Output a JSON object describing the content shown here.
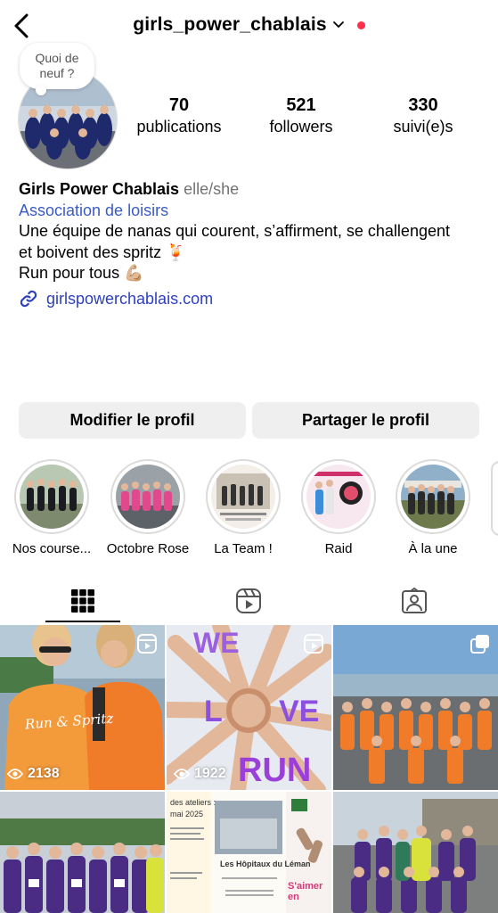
{
  "header": {
    "username": "girls_power_chablais"
  },
  "note": {
    "text": "Quoi de neuf ?"
  },
  "stats": {
    "posts_count": "70",
    "posts_label": "publications",
    "followers_count": "521",
    "followers_label": "followers",
    "following_count": "330",
    "following_label": "suivi(e)s"
  },
  "bio": {
    "name": "Girls Power Chablais",
    "pronouns": "elle/she",
    "category": "Association de loisirs",
    "line1": "Une équipe de nanas qui courent, s’affirment, se challengent",
    "line2": "et boivent des spritz 🍹",
    "line3": "Run pour tous 💪🏼",
    "link": "girlspowerchablais.com"
  },
  "buttons": {
    "edit": "Modifier le profil",
    "share": "Partager le profil"
  },
  "highlights": [
    {
      "label": "Nos course..."
    },
    {
      "label": "Octobre Rose"
    },
    {
      "label": "La Team !"
    },
    {
      "label": "Raid"
    },
    {
      "label": "À la une"
    }
  ],
  "grid": {
    "posts": [
      {
        "views": "2138",
        "type": "reel",
        "shirt_text": "Run & Spritz"
      },
      {
        "views": "1922",
        "type": "reel",
        "overlay_text": [
          "WE",
          "L",
          "VE",
          "RUN"
        ]
      },
      {
        "type": "carousel"
      },
      {
        "type": "photo"
      },
      {
        "type": "document",
        "lines": [
          "des ateliers :",
          "mai 2025",
          "Les Hôpitaux du Léman",
          "S'aimer en"
        ]
      },
      {
        "type": "photo"
      }
    ]
  },
  "colors": {
    "link_blue": "#3b5bc6",
    "button_bg": "#efefef",
    "live_dot": "#ff2f4b"
  }
}
